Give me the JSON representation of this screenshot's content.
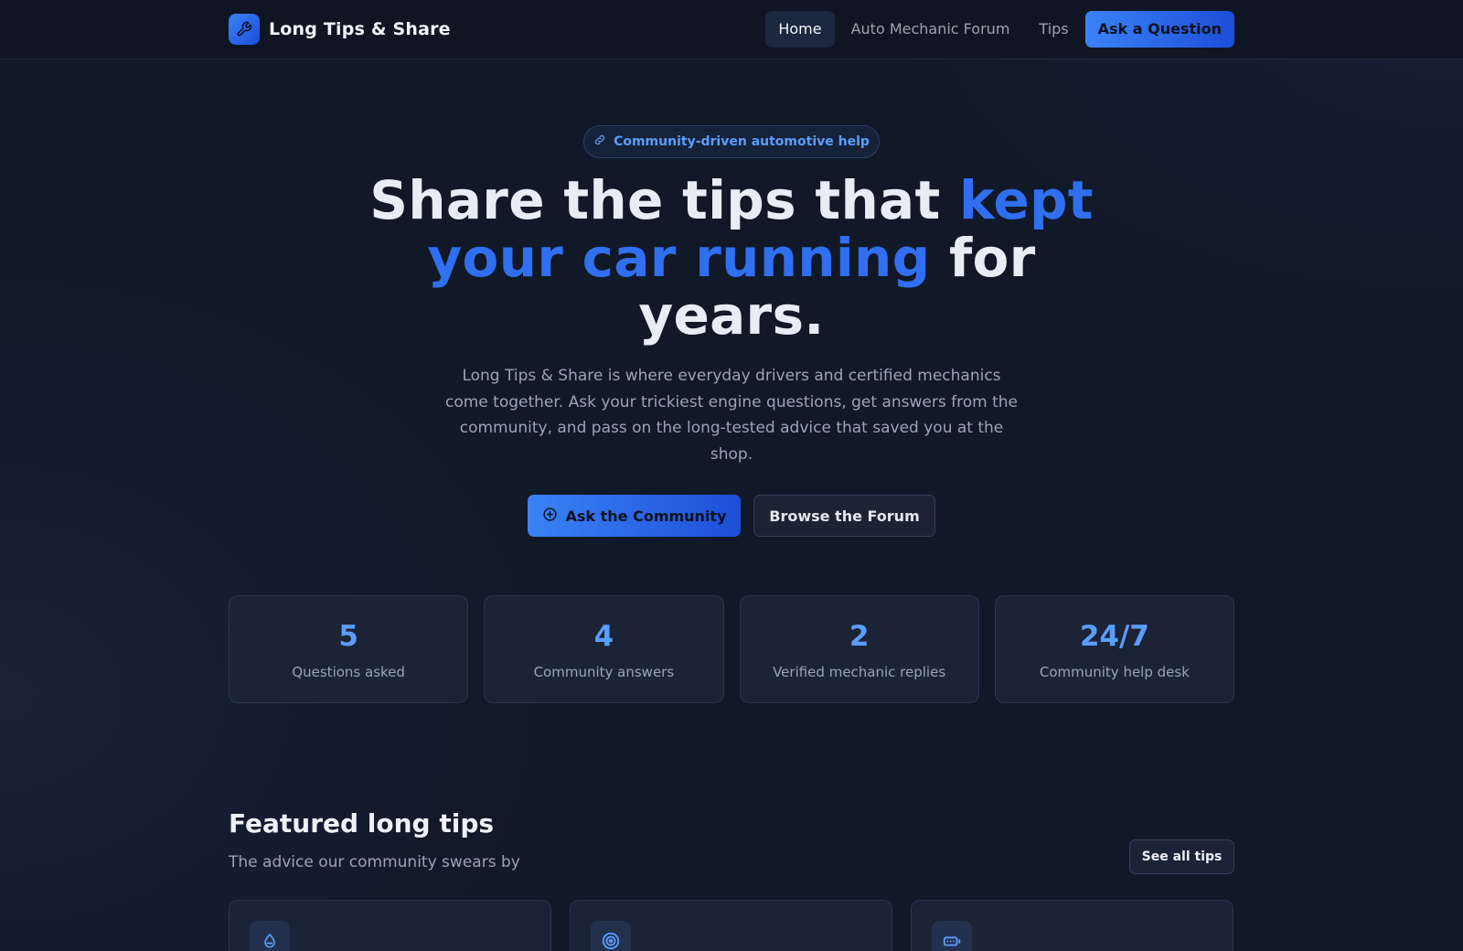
{
  "nav": {
    "brand": "Long Tips & Share",
    "links": [
      "Home",
      "Auto Mechanic Forum",
      "Tips"
    ],
    "active": "Home",
    "cta": "Ask a Question"
  },
  "hero": {
    "pill": "Community-driven automotive help",
    "title_pre": "Share the tips that ",
    "title_accent": "kept your car running",
    "title_post": " for years.",
    "description": "Long Tips & Share is where everyday drivers and certified mechanics come together. Ask your trickiest engine questions, get answers from the community, and pass on the long-tested advice that saved you at the shop.",
    "primary_button": "Ask the Community",
    "secondary_button": "Browse the Forum"
  },
  "stats": [
    {
      "value": "5",
      "label": "Questions asked"
    },
    {
      "value": "4",
      "label": "Community answers"
    },
    {
      "value": "2",
      "label": "Verified mechanic replies"
    },
    {
      "value": "24/7",
      "label": "Community help desk"
    }
  ],
  "featured": {
    "title": "Featured long tips",
    "subtitle": "The advice our community swears by",
    "see_all": "See all tips",
    "cards": [
      {
        "icon": "droplet-icon"
      },
      {
        "icon": "target-icon"
      },
      {
        "icon": "battery-icon"
      }
    ]
  },
  "colors": {
    "accent": "#2f6ff0",
    "accent_light": "#5b9dfb",
    "background": "#111827",
    "card": "#1b2336"
  }
}
